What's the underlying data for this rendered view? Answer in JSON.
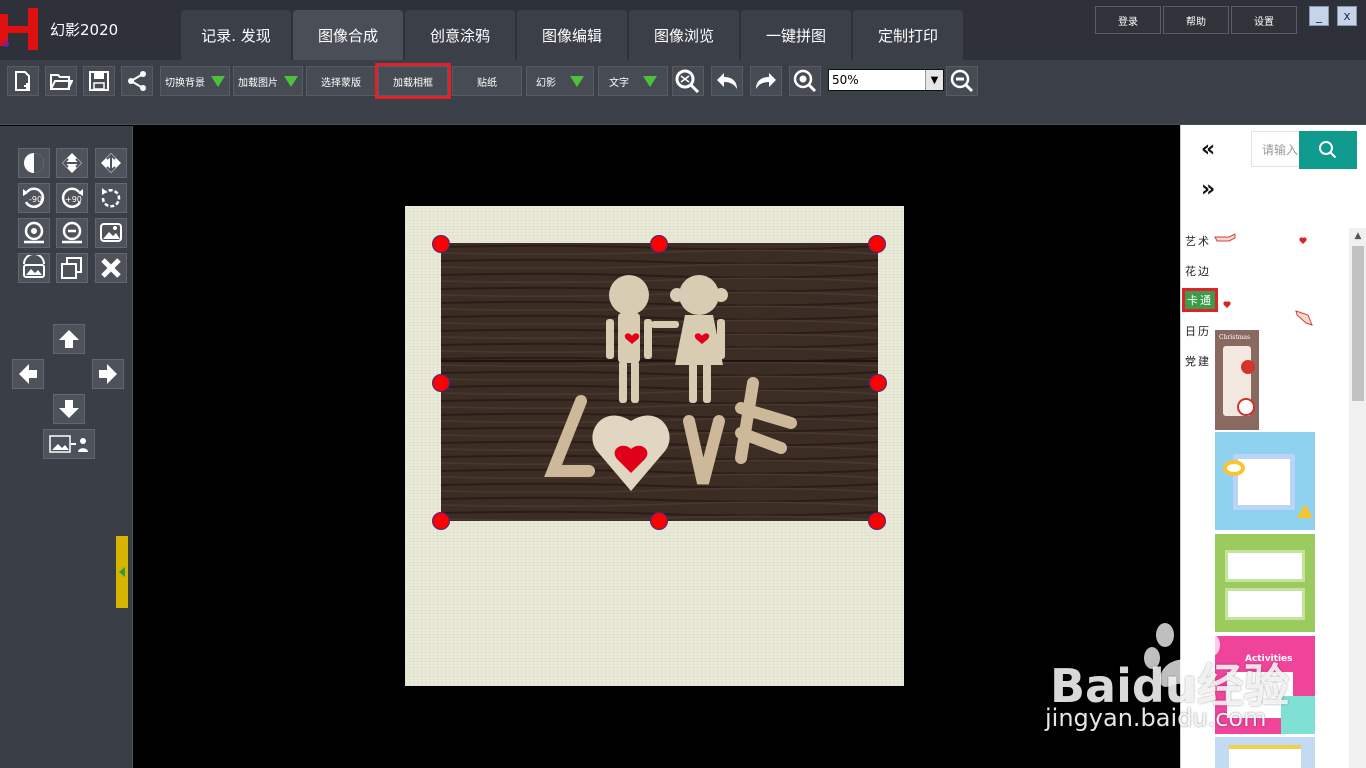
{
  "app": {
    "title": "幻影2020"
  },
  "tabs": [
    {
      "label": "记录. 发现"
    },
    {
      "label": "图像合成"
    },
    {
      "label": "创意涂鸦"
    },
    {
      "label": "图像编辑"
    },
    {
      "label": "图像浏览"
    },
    {
      "label": "一键拼图"
    },
    {
      "label": "定制打印"
    }
  ],
  "active_tab": "图像合成",
  "system_buttons": {
    "login": "登录",
    "help": "帮助",
    "settings": "设置"
  },
  "window_controls": {
    "minimize": "_",
    "close": "x"
  },
  "toolbar": {
    "switch_background": "切换背景",
    "load_image": "加载图片",
    "select_template": "选择蒙版",
    "load_frame": "加载相框",
    "sticker": "贴纸",
    "phantom": "幻影",
    "text": "文字",
    "zoom_value": "50%",
    "zoom_arrow": "▼"
  },
  "icons": {
    "new": "new-file-icon",
    "open": "open-folder-icon",
    "save": "save-icon",
    "share": "share-icon",
    "magic": "magic-search-icon",
    "undo": "undo-icon",
    "redo": "redo-icon",
    "zoom_in": "zoom-in-icon",
    "zoom_out": "zoom-out-icon"
  },
  "left_tools": {
    "rotate_left_label": "-90",
    "rotate_right_label": "+90"
  },
  "right_panel": {
    "search_placeholder": "请输入",
    "prev": "«",
    "next": "»",
    "categories": [
      "艺术",
      "花边",
      "卡通",
      "日历",
      "党建"
    ],
    "selected_category": "卡通",
    "scroll_up": "▲",
    "thumb_christmas_text": "Christmas",
    "thumb_activities_text": "Activities"
  },
  "watermark": {
    "brand": "Baidu经验",
    "url": "jingyan.baidu.com"
  },
  "colors": {
    "accent_red": "#e0202a",
    "teal": "#0f9b8e",
    "green_arrow": "#4ec13b",
    "handle": "#ff0000"
  }
}
